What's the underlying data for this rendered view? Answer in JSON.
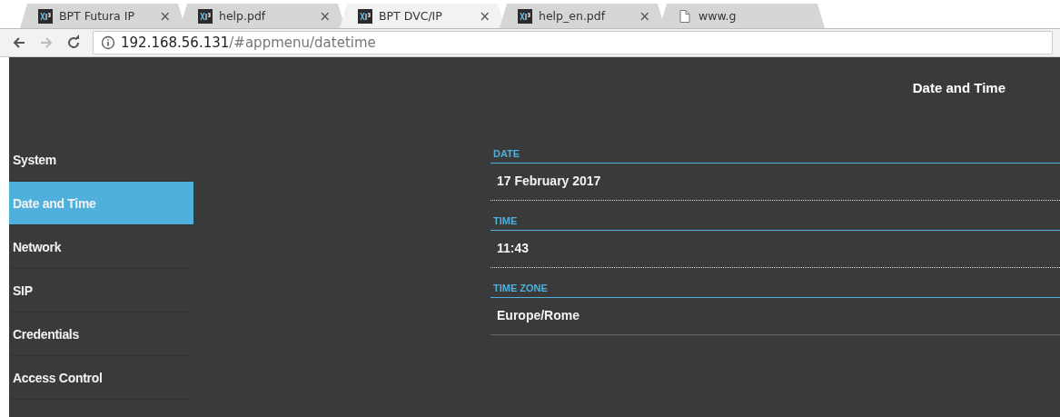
{
  "browser": {
    "tabs": [
      {
        "title": "BPT Futura IP",
        "kind": "app",
        "selected": false,
        "close": "×"
      },
      {
        "title": "help.pdf",
        "kind": "app",
        "selected": false,
        "close": "×"
      },
      {
        "title": "BPT DVC/IP",
        "kind": "app",
        "selected": true,
        "close": "×"
      },
      {
        "title": "help_en.pdf",
        "kind": "app",
        "selected": false,
        "close": "×"
      },
      {
        "title": "www.g",
        "kind": "page",
        "selected": false
      }
    ],
    "address": {
      "host": "192.168.56.131",
      "path": "/#appmenu/datetime"
    }
  },
  "header": {
    "title": "Date and Time"
  },
  "sidebar": {
    "items": [
      {
        "label": "System",
        "selected": false
      },
      {
        "label": "Date and Time",
        "selected": true
      },
      {
        "label": "Network",
        "selected": false
      },
      {
        "label": "SIP",
        "selected": false
      },
      {
        "label": "Credentials",
        "selected": false
      },
      {
        "label": "Access Control",
        "selected": false
      }
    ]
  },
  "fields": [
    {
      "label": "DATE",
      "value": "17 February 2017"
    },
    {
      "label": "TIME",
      "value": "11:43"
    },
    {
      "label": "TIME ZONE",
      "value": "Europe/Rome"
    }
  ]
}
